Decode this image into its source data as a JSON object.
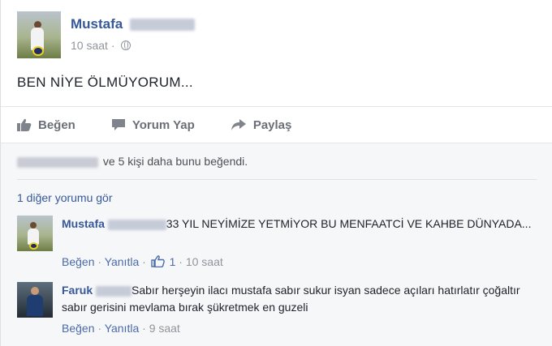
{
  "post": {
    "author_first": "Mustafa",
    "time": "10 saat",
    "separator": "·",
    "text": "BEN NİYE ÖLMÜYORUM..."
  },
  "actions": {
    "like": "Beğen",
    "comment": "Yorum Yap",
    "share": "Paylaş"
  },
  "likes_summary": "ve 5 kişi daha bunu beğendi.",
  "more_comments": "1 diğer yorumu gör",
  "comments": [
    {
      "author_first": "Mustafa",
      "text": "33 YIL NEYİMİZE YETMİYOR BU MENFAATCİ VE KAHBE DÜNYADA...",
      "like": "Beğen",
      "reply": "Yanıtla",
      "like_count": "1",
      "time": "10 saat"
    },
    {
      "author_first": "Faruk",
      "text": "Sabır herşeyin ilacı mustafa sabır sukur isyan sadece açıları hatırlatır çoğaltır sabır gerisini mevlama bırak şükretmek en guzeli",
      "like": "Beğen",
      "reply": "Yanıtla",
      "time": "9 saat"
    }
  ],
  "colors": {
    "link_blue": "#365899",
    "meta_grey": "#90949c",
    "action_grey": "#6b6f78"
  }
}
